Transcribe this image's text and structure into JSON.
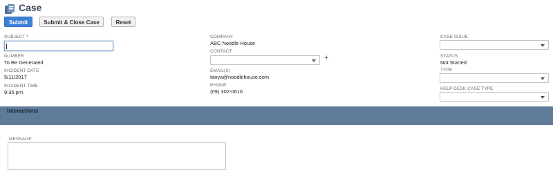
{
  "header": {
    "title": "Case",
    "icon": "case-icon"
  },
  "toolbar": {
    "submit_label": "Submit",
    "submit_close_label": "Submit & Close Case",
    "reset_label": "Reset"
  },
  "colors": {
    "primary_button": "#3f7fd6",
    "section_bar": "#5f7b99"
  },
  "form": {
    "subject": {
      "label": "SUBJECT",
      "required_mark": "*",
      "value": ""
    },
    "number": {
      "label": "NUMBER",
      "value": "To Be Generated"
    },
    "incident_date": {
      "label": "INCIDENT DATE",
      "value": "5/11/2017"
    },
    "incident_time": {
      "label": "INCIDENT TIME",
      "value": "9:35 pm"
    },
    "company": {
      "label": "COMPANY",
      "value": "ABC Noodle House"
    },
    "contact": {
      "label": "CONTACT",
      "value": "",
      "add_icon": "plus-icon"
    },
    "emails": {
      "label": "EMAIL(S)",
      "value": "tanya@noodlehouse.com"
    },
    "phone": {
      "label": "PHONE",
      "value": "(09) 302-0616"
    },
    "case_issue": {
      "label": "CASE ISSUE",
      "value": ""
    },
    "status": {
      "label": "STATUS",
      "value": "Not Started"
    },
    "type": {
      "label": "TYPE",
      "value": ""
    },
    "help_desk_case_type": {
      "label": "HELP DESK CASE TYPE",
      "value": ""
    }
  },
  "interactions": {
    "title": "Interactions",
    "message_label": "MESSAGE",
    "message_value": ""
  }
}
